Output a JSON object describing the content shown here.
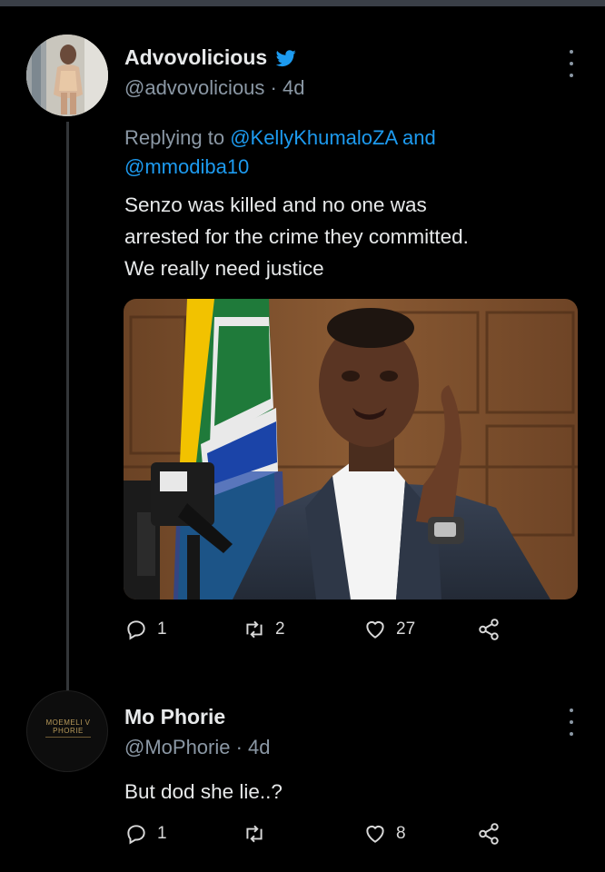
{
  "tweets": [
    {
      "name": "Advovolicious",
      "handle": "@advovolicious",
      "time": "4d",
      "handle_line": "@advovolicious · 4d",
      "reply_prefix": "Replying to ",
      "reply_user_1": "@KellyKhumaloZA",
      "reply_and": " and",
      "reply_user_2": "@mmodiba10",
      "text_lines": [
        "Senzo was killed and no one was",
        "arrested for the crime they committed.",
        "We really need justice"
      ],
      "replies": "1",
      "retweets": "2",
      "likes": "27"
    },
    {
      "name": "Mo Phorie",
      "handle": "@MoPhorie",
      "time": "4d",
      "handle_line": "@MoPhorie · 4d",
      "text_lines": [
        "But dod she lie..?"
      ],
      "avatar_text": "MOEMELI V PHORIE",
      "replies": "1",
      "retweets": "",
      "likes": "8"
    }
  ],
  "colors": {
    "background": "#000000",
    "text_primary": "#e7e9ea",
    "text_secondary": "#8b98a5",
    "link": "#1d9bf0",
    "verified": "#1d9bf0"
  },
  "icons": [
    "twitter-bird-icon",
    "more-icon",
    "reply-icon",
    "retweet-icon",
    "like-icon",
    "share-icon"
  ]
}
